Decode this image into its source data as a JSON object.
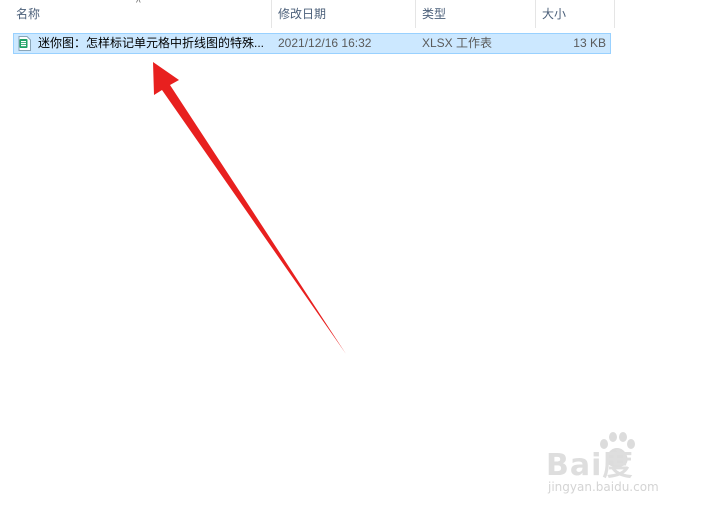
{
  "columns": {
    "name": "名称",
    "modified": "修改日期",
    "type": "类型",
    "size": "大小"
  },
  "file": {
    "name": "迷你图：怎样标记单元格中折线图的特殊...",
    "modified": "2021/12/16 16:32",
    "type": "XLSX 工作表",
    "size": "13 KB",
    "icon": "excel-file-icon"
  },
  "colors": {
    "selection_bg": "#cce8ff",
    "selection_border": "#99d1ff",
    "arrow": "#e8201f",
    "icon_green": "#21a366"
  },
  "watermark": {
    "brand": "Bai度",
    "site": "jingyan.baidu.com"
  }
}
